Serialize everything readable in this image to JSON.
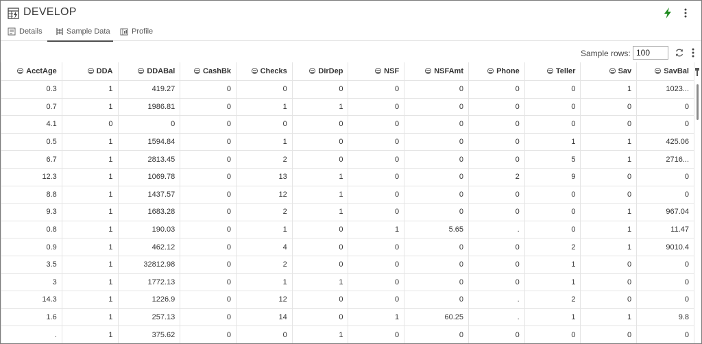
{
  "title": "DEVELOP",
  "tabs": [
    {
      "label": "Details",
      "icon": "details-icon",
      "active": false
    },
    {
      "label": "Sample Data",
      "icon": "sample-data-icon",
      "active": true
    },
    {
      "label": "Profile",
      "icon": "profile-icon",
      "active": false
    }
  ],
  "toolbar": {
    "sample_rows_label": "Sample rows:",
    "sample_rows_value": "100"
  },
  "colors": {
    "bolt": "#1e8a1e",
    "active_tab": "#4d4d4d"
  },
  "columns": [
    "AcctAge",
    "DDA",
    "DDABal",
    "CashBk",
    "Checks",
    "DirDep",
    "NSF",
    "NSFAmt",
    "Phone",
    "Teller",
    "Sav",
    "SavBal"
  ],
  "rows": [
    [
      "0.3",
      "1",
      "419.27",
      "0",
      "0",
      "0",
      "0",
      "0",
      "0",
      "0",
      "1",
      "1023..."
    ],
    [
      "0.7",
      "1",
      "1986.81",
      "0",
      "1",
      "1",
      "0",
      "0",
      "0",
      "0",
      "0",
      "0"
    ],
    [
      "4.1",
      "0",
      "0",
      "0",
      "0",
      "0",
      "0",
      "0",
      "0",
      "0",
      "0",
      "0"
    ],
    [
      "0.5",
      "1",
      "1594.84",
      "0",
      "1",
      "0",
      "0",
      "0",
      "0",
      "1",
      "1",
      "425.06"
    ],
    [
      "6.7",
      "1",
      "2813.45",
      "0",
      "2",
      "0",
      "0",
      "0",
      "0",
      "5",
      "1",
      "2716..."
    ],
    [
      "12.3",
      "1",
      "1069.78",
      "0",
      "13",
      "1",
      "0",
      "0",
      "2",
      "9",
      "0",
      "0"
    ],
    [
      "8.8",
      "1",
      "1437.57",
      "0",
      "12",
      "1",
      "0",
      "0",
      "0",
      "0",
      "0",
      "0"
    ],
    [
      "9.3",
      "1",
      "1683.28",
      "0",
      "2",
      "1",
      "0",
      "0",
      "0",
      "0",
      "1",
      "967.04"
    ],
    [
      "0.8",
      "1",
      "190.03",
      "0",
      "1",
      "0",
      "1",
      "5.65",
      ".",
      "0",
      "1",
      "11.47"
    ],
    [
      "0.9",
      "1",
      "462.12",
      "0",
      "4",
      "0",
      "0",
      "0",
      "0",
      "2",
      "1",
      "9010.4"
    ],
    [
      "3.5",
      "1",
      "32812.98",
      "0",
      "2",
      "0",
      "0",
      "0",
      "0",
      "1",
      "0",
      "0"
    ],
    [
      "3",
      "1",
      "1772.13",
      "0",
      "1",
      "1",
      "0",
      "0",
      "0",
      "1",
      "0",
      "0"
    ],
    [
      "14.3",
      "1",
      "1226.9",
      "0",
      "12",
      "0",
      "0",
      "0",
      ".",
      "2",
      "0",
      "0"
    ],
    [
      "1.6",
      "1",
      "257.13",
      "0",
      "14",
      "0",
      "1",
      "60.25",
      ".",
      "1",
      "1",
      "9.8"
    ],
    [
      ".",
      "1",
      "375.62",
      "0",
      "0",
      "1",
      "0",
      "0",
      "0",
      "0",
      "0",
      "0"
    ]
  ]
}
